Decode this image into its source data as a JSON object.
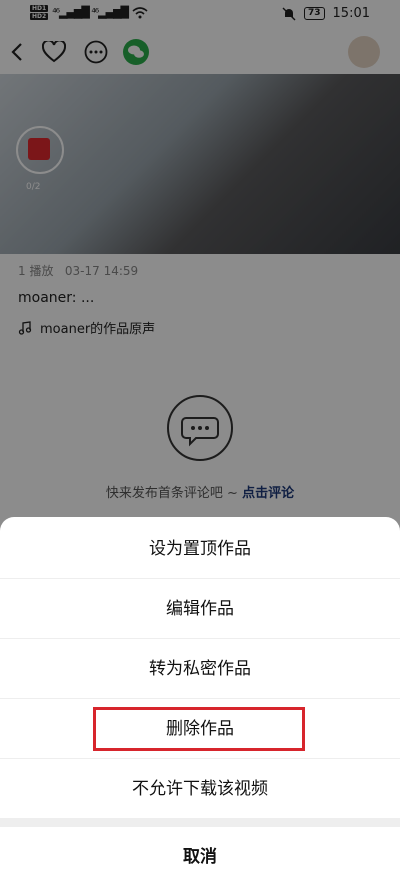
{
  "status_bar": {
    "time": "15:01",
    "battery": "73",
    "signal_text": "HD 1 / HD 2"
  },
  "video": {
    "redpacket_count": "0/2"
  },
  "meta": {
    "plays": "1 播放",
    "date": "03-17 14:59"
  },
  "caption": "moaner:  ...",
  "music": "moaner的作品原声",
  "empty_comments": {
    "text": "快来发布首条评论吧 ~ ",
    "link": "点击评论"
  },
  "sheet": {
    "items": [
      "设为置顶作品",
      "编辑作品",
      "转为私密作品",
      "删除作品",
      "不允许下载该视频"
    ],
    "cancel": "取消"
  },
  "colors": {
    "highlight": "#d7252c",
    "link": "#1e3a7a",
    "redpacket": "#e0282e",
    "wechat": "#2bad4b"
  }
}
